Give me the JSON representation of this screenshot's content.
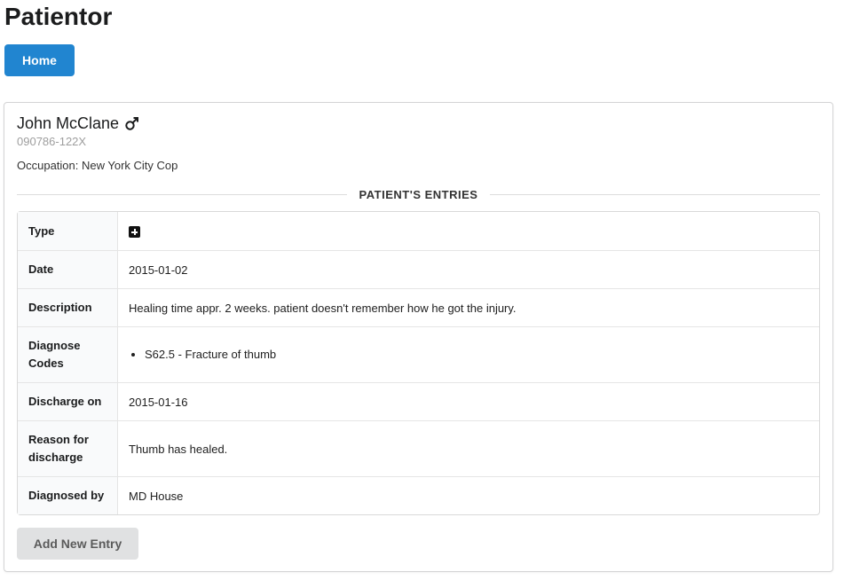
{
  "app": {
    "title": "Patientor"
  },
  "nav": {
    "home_label": "Home"
  },
  "patient": {
    "name": "John McClane",
    "gender_icon": "male-icon",
    "ssn": "090786-122X",
    "occupation_text": "Occupation: New York City Cop"
  },
  "entries_section": {
    "heading": "PATIENT'S ENTRIES"
  },
  "entry": {
    "type_label": "Type",
    "type_icon": "plus-square-icon",
    "date_label": "Date",
    "date": "2015-01-02",
    "description_label": "Description",
    "description": "Healing time appr. 2 weeks. patient doesn't remember how he got the injury.",
    "diagnose_label": "Diagnose Codes",
    "diagnose_codes": [
      "S62.5 - Fracture of thumb"
    ],
    "discharge_label": "Discharge on",
    "discharge_date": "2015-01-16",
    "reason_label": "Reason for discharge",
    "reason": "Thumb has healed.",
    "diagnosed_by_label": "Diagnosed by",
    "diagnosed_by": "MD House"
  },
  "actions": {
    "add_entry_label": "Add New Entry"
  },
  "colors": {
    "primary": "#2185d0",
    "secondary": "#e0e1e2"
  }
}
